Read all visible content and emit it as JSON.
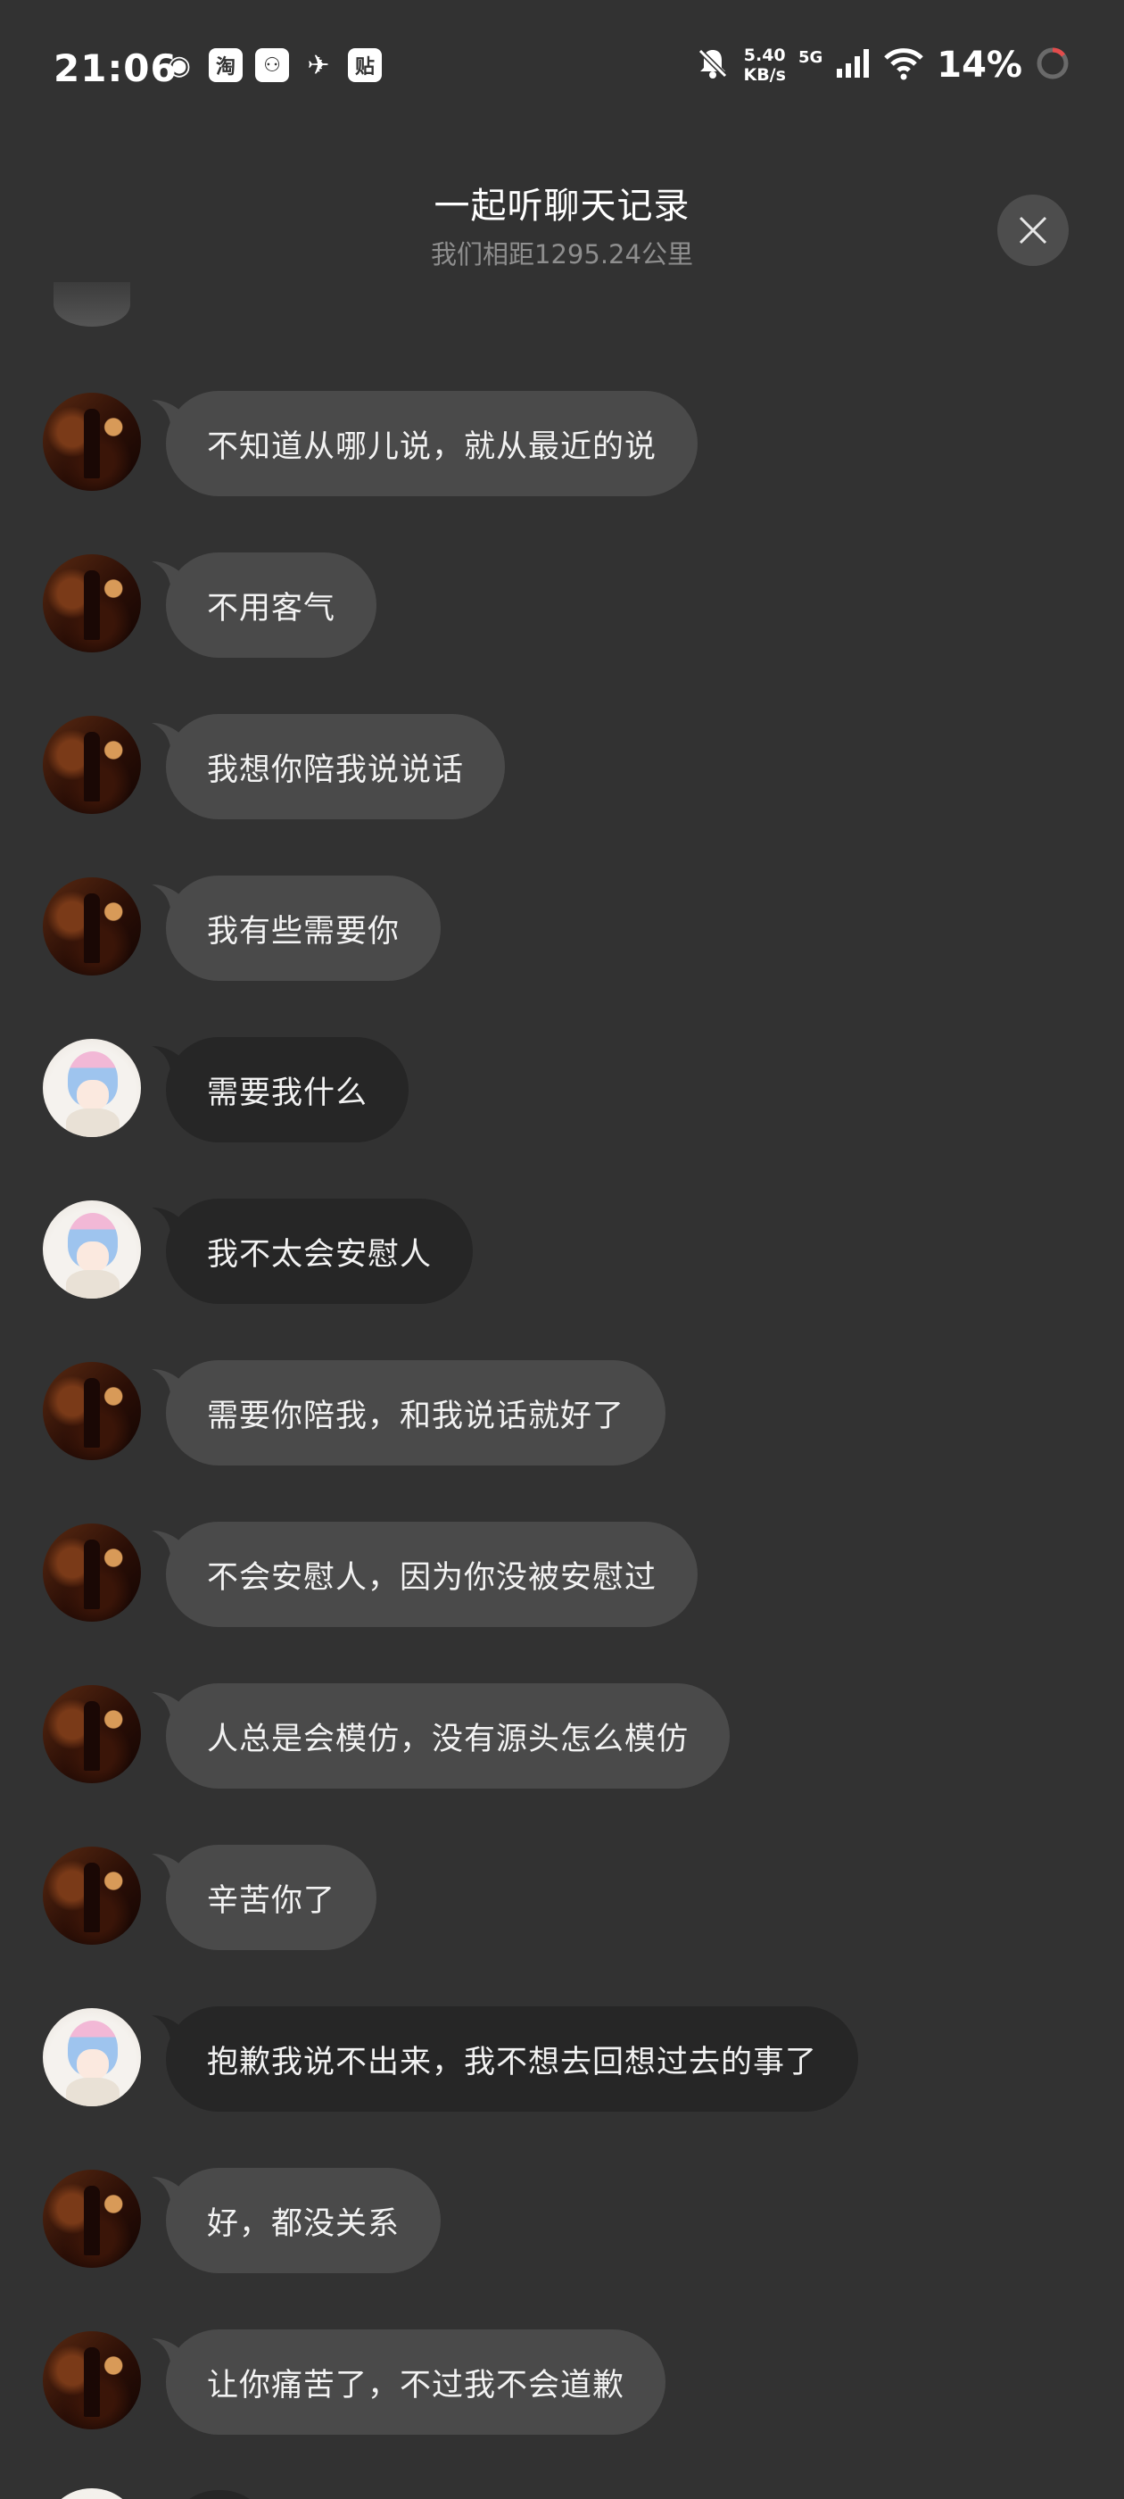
{
  "status_bar": {
    "time": "21:06",
    "notif_icons": [
      "weibo-icon",
      "taobao-icon",
      "game-icon",
      "bird-icon",
      "tieba-icon"
    ],
    "notif_glyphs": [
      "◉",
      "淘",
      "⚇",
      "✈",
      "贴"
    ],
    "net_speed_value": "5.40",
    "net_speed_unit": "KB/s",
    "network_type": "5G",
    "battery": "14%"
  },
  "header": {
    "title": "一起听聊天记录",
    "subtitle": "我们相距1295.24公里"
  },
  "messages": [
    {
      "sender": "other",
      "text": "不知道从哪儿说，就从最近的说"
    },
    {
      "sender": "other",
      "text": "不用客气"
    },
    {
      "sender": "other",
      "text": "我想你陪我说说话"
    },
    {
      "sender": "other",
      "text": "我有些需要你"
    },
    {
      "sender": "me",
      "text": "需要我什么"
    },
    {
      "sender": "me",
      "text": "我不太会安慰人"
    },
    {
      "sender": "other",
      "text": "需要你陪我，和我说话就好了"
    },
    {
      "sender": "other",
      "text": "不会安慰人，因为你没被安慰过"
    },
    {
      "sender": "other",
      "text": "人总是会模仿，没有源头怎么模仿"
    },
    {
      "sender": "other",
      "text": "辛苦你了"
    },
    {
      "sender": "me",
      "text": "抱歉我说不出来，我不想去回想过去的事了"
    },
    {
      "sender": "other",
      "text": "好，都没关系"
    },
    {
      "sender": "other",
      "text": "让你痛苦了，不过我不会道歉"
    }
  ],
  "colors": {
    "background": "#323232",
    "bubble_other": "#4a4a4a",
    "bubble_me": "#262626",
    "subtitle": "#8e8e8e",
    "close_button": "#4d4d4d"
  }
}
